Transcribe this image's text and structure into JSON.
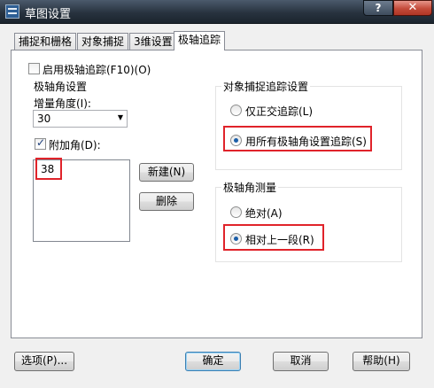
{
  "window": {
    "title": "草图设置",
    "help_glyph": "?",
    "close_glyph": "✕"
  },
  "tabs": [
    {
      "label": "捕捉和栅格",
      "active": false
    },
    {
      "label": "对象捕捉",
      "active": false
    },
    {
      "label": "3维设置",
      "active": false
    },
    {
      "label": "极轴追踪",
      "active": true
    }
  ],
  "enable_polar": {
    "label": "启用极轴追踪(F10)(O)",
    "checked": false
  },
  "polar_angle": {
    "group_title": "极轴角设置",
    "increment_label": "增量角度(I):",
    "increment_value": "30",
    "additional_label": "附加角(D):",
    "additional_checked": true,
    "angles": [
      "38"
    ],
    "new_button": "新建(N)",
    "delete_button": "删除"
  },
  "object_snap_tracking": {
    "group_title": "对象捕捉追踪设置",
    "options": [
      {
        "label": "仅正交追踪(L)",
        "selected": false
      },
      {
        "label": "用所有极轴角设置追踪(S)",
        "selected": true
      }
    ]
  },
  "polar_measurement": {
    "group_title": "极轴角测量",
    "options": [
      {
        "label": "绝对(A)",
        "selected": false
      },
      {
        "label": "相对上一段(R)",
        "selected": true
      }
    ]
  },
  "footer": {
    "options_button": "选项(P)...",
    "ok_button": "确定",
    "cancel_button": "取消",
    "help_button": "帮助(H)"
  },
  "colors": {
    "highlight": "#e0232a",
    "titlebar": "#28333f",
    "close_button": "#c44b3a"
  }
}
